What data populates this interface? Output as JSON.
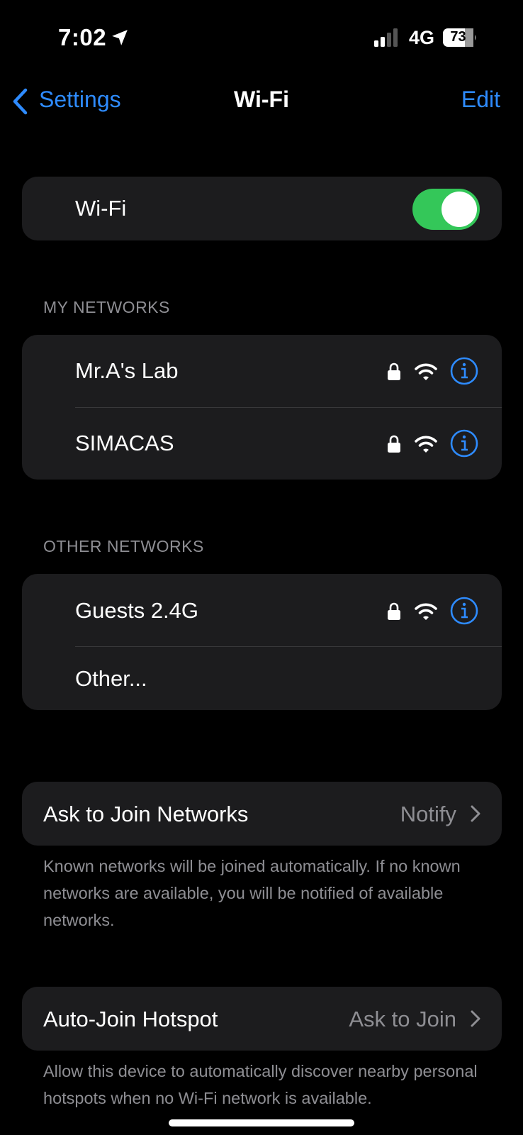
{
  "status_bar": {
    "time": "7:02",
    "network": "4G",
    "battery": "73"
  },
  "nav": {
    "back_label": "Settings",
    "title": "Wi-Fi",
    "edit_label": "Edit"
  },
  "wifi_toggle": {
    "label": "Wi-Fi",
    "on": true
  },
  "my_networks": {
    "header": "MY NETWORKS",
    "items": [
      {
        "name": "Mr.A's Lab"
      },
      {
        "name": "SIMACAS"
      }
    ]
  },
  "other_networks": {
    "header": "OTHER NETWORKS",
    "items": [
      {
        "name": "Guests 2.4G"
      }
    ],
    "other_label": "Other..."
  },
  "ask_to_join": {
    "label": "Ask to Join Networks",
    "value": "Notify",
    "footer": "Known networks will be joined automatically. If no known networks are available, you will be notified of available networks."
  },
  "auto_join_hotspot": {
    "label": "Auto-Join Hotspot",
    "value": "Ask to Join",
    "footer": "Allow this device to automatically discover nearby personal hotspots when no Wi-Fi network is available."
  },
  "colors": {
    "accent": "#2e8bff",
    "toggle_on": "#34c759",
    "group_bg": "#1c1c1e",
    "secondary_text": "#8e8e93"
  }
}
